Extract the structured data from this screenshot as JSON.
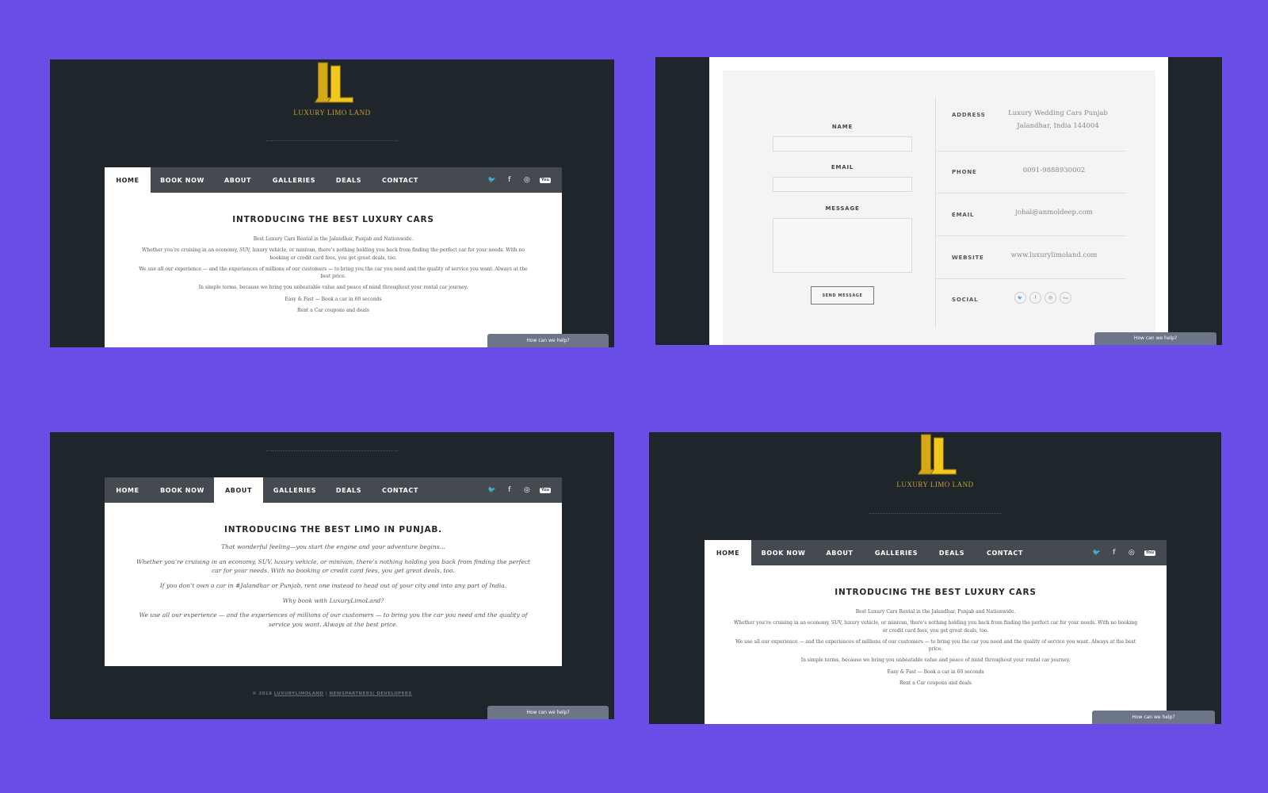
{
  "brand": {
    "logo_text": "LUXURY LIMO LAND",
    "gold": "#c9a233"
  },
  "nav": {
    "items": [
      "HOME",
      "BOOK NOW",
      "ABOUT",
      "GALLERIES",
      "DEALS",
      "CONTACT"
    ],
    "social_icons": [
      "twitter-icon",
      "facebook-icon",
      "instagram-icon",
      "youtube-icon"
    ],
    "twitter_glyph": "🐦",
    "facebook_glyph": "f",
    "instagram_glyph": "◎",
    "youtube_glyph": "You"
  },
  "home": {
    "title": "INTRODUCING THE BEST LUXURY CARS",
    "p1": "Best Luxury Cars Rental in the Jalandhar, Punjab and Nationwide.",
    "p2": "Whether you’re cruising in an economy, SUV, luxury vehicle, or minivan, there’s nothing holding you back from finding the perfect car for your needs. With no booking or credit card fees, you get great deals, too.",
    "p3": "We use all our experience — and the experiences of millions of our customers — to bring you the car you need and the quality of service you want. Always at the best price.",
    "p4": "In simple terms, because we bring you unbeatable value and peace of mind throughout your rental car journey.",
    "p5_tl": "Easy & Fast — Book a car in 60 seconds",
    "p5_br": "Easy & Fast — Book a car in 60 seconds",
    "p6": "Rent a Car coupons and deals"
  },
  "about": {
    "title": "INTRODUCING THE BEST LIMO IN PUNJAB.",
    "p1": "That wonderful feeling—you start the engine and your adventure begins...",
    "p2": "Whether you’re cruising in an economy, SUV, luxury vehicle, or minivan, there’s nothing holding you back from finding the perfect car for your needs. With no booking or credit card fees, you get great deals, too.",
    "p3": "If you don’t own a car in #Jalandhar or Punjab, rent one instead to head out of your city and into any part of India.",
    "p4": "Why book with LuxuryLimoLand?",
    "p5": "We use all our experience — and the experiences of millions of our customers — to bring you the car you need and the quality of service you want. Always at the best price."
  },
  "footer": {
    "copyright": "© 2018",
    "site": "LUXURYLIMOLAND",
    "sep": "|",
    "dev": "NEWSPARTNERS| DEVELOPERS"
  },
  "contact": {
    "name_label": "NAME",
    "email_label": "EMAIL",
    "message_label": "MESSAGE",
    "send_label": "SEND MESSAGE",
    "address_label": "ADDRESS",
    "address_line1": "Luxury Wedding Cars Punjab",
    "address_line2": "Jalandhar, India 144004",
    "phone_label": "PHONE",
    "phone": "0091-9888930002",
    "email_info_label": "EMAIL",
    "email": "johal@anmoldeep.com",
    "website_label": "WEBSITE",
    "website": "www.luxurylimoland.com",
    "social_label": "SOCIAL"
  },
  "help_widget": {
    "label": "How can we help?"
  }
}
